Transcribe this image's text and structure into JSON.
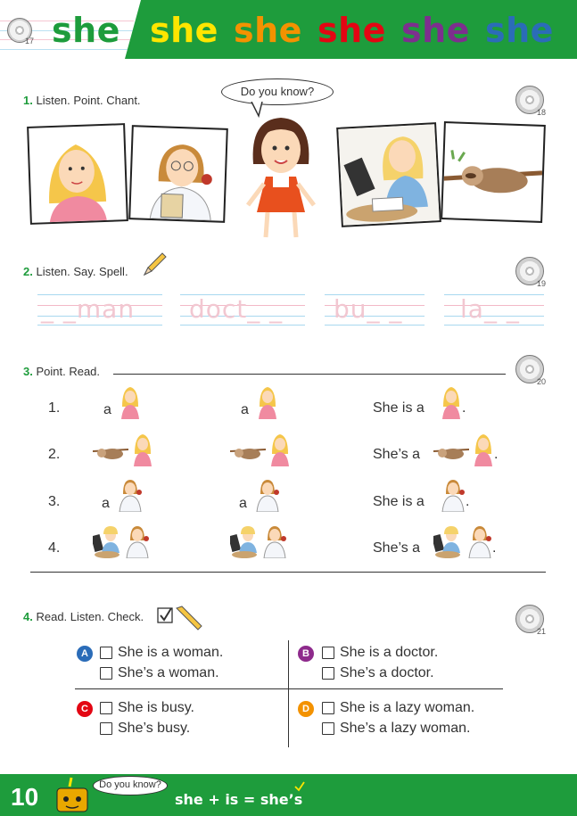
{
  "header": {
    "words": [
      {
        "text": "she",
        "color": "#1e9c3c"
      },
      {
        "text": "she",
        "color": "#ffe500"
      },
      {
        "text": "she",
        "color": "#f39200"
      },
      {
        "text": "she",
        "color": "#e30613"
      },
      {
        "text": "she",
        "color": "#7d2f8e"
      },
      {
        "text": "she",
        "color": "#2b6cb8"
      }
    ],
    "track": "17"
  },
  "section1": {
    "number": "1.",
    "title": "Listen. Point. Chant.",
    "track": "18",
    "bubble": "Do you know?",
    "pictures": [
      "woman",
      "doctor",
      "girl",
      "busy woman",
      "lazy sloth"
    ]
  },
  "section2": {
    "number": "2.",
    "title": "Listen. Say. Spell.",
    "track": "19",
    "words": [
      "_ _man",
      "doct_ _",
      "bu_ _",
      "la_ _"
    ]
  },
  "section3": {
    "number": "3.",
    "title": "Point. Read.",
    "track": "20",
    "rows": [
      {
        "num": "1.",
        "col1": "a",
        "col2": "a",
        "col3a": "She is a",
        "col3b": "."
      },
      {
        "num": "2.",
        "col1": "",
        "col2": "",
        "col3a": "She’s a",
        "col3b": "."
      },
      {
        "num": "3.",
        "col1": "a",
        "col2": "a",
        "col3a": "She is a",
        "col3b": "."
      },
      {
        "num": "4.",
        "col1": "",
        "col2": "",
        "col3a": "She’s a",
        "col3b": "."
      }
    ]
  },
  "section4": {
    "number": "4.",
    "title": "Read. Listen. Check.",
    "track": "21",
    "groups": [
      {
        "letter": "A",
        "color": "#2b6cb8",
        "options": [
          "She is a woman.",
          "She’s a woman."
        ]
      },
      {
        "letter": "B",
        "color": "#8e2a8c",
        "options": [
          "She is a doctor.",
          "She’s a doctor."
        ]
      },
      {
        "letter": "C",
        "color": "#e30613",
        "options": [
          "She is busy.",
          "She’s busy."
        ]
      },
      {
        "letter": "D",
        "color": "#f39200",
        "options": [
          "She is a lazy woman.",
          "She’s a lazy woman."
        ]
      }
    ]
  },
  "footer": {
    "page": "10",
    "bubble": "Do you know?",
    "formula": "she + is = she’s"
  }
}
